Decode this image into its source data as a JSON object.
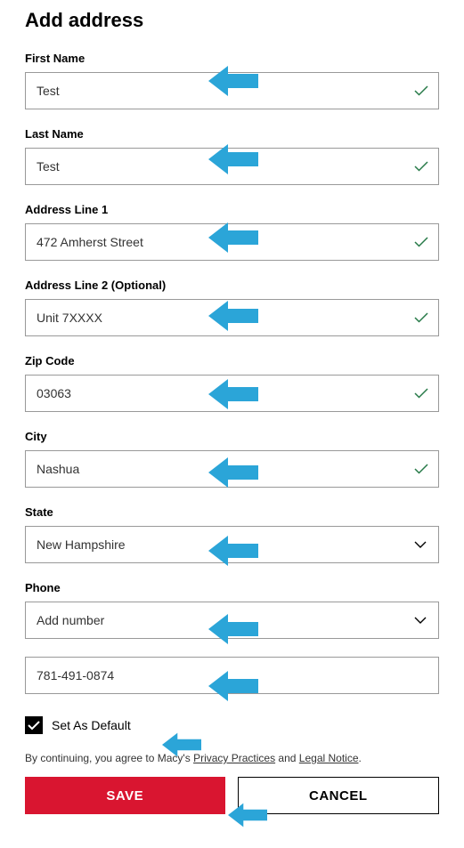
{
  "title": "Add address",
  "fields": {
    "first_name": {
      "label": "First Name",
      "value": "Test",
      "valid": true
    },
    "last_name": {
      "label": "Last Name",
      "value": "Test",
      "valid": true
    },
    "address1": {
      "label": "Address Line 1",
      "value": "472 Amherst Street",
      "valid": true
    },
    "address2": {
      "label": "Address Line 2 (Optional)",
      "value": "Unit 7XXXX",
      "valid": true
    },
    "zip": {
      "label": "Zip Code",
      "value": "03063",
      "valid": true
    },
    "city": {
      "label": "City",
      "value": "Nashua",
      "valid": true
    },
    "state": {
      "label": "State",
      "value": "New Hampshire"
    },
    "phone_select": {
      "label": "Phone",
      "value": "Add number"
    },
    "phone_number": {
      "value": "781-491-0874"
    }
  },
  "checkbox": {
    "label": "Set As Default",
    "checked": true
  },
  "legal": {
    "prefix": "By continuing, you agree to Macy's ",
    "link1": "Privacy Practices",
    "mid": " and ",
    "link2": "Legal Notice",
    "suffix": "."
  },
  "buttons": {
    "save": "SAVE",
    "cancel": "CANCEL"
  },
  "colors": {
    "primary": "#d91530",
    "arrow": "#2ba5d8",
    "check": "#277a48"
  }
}
